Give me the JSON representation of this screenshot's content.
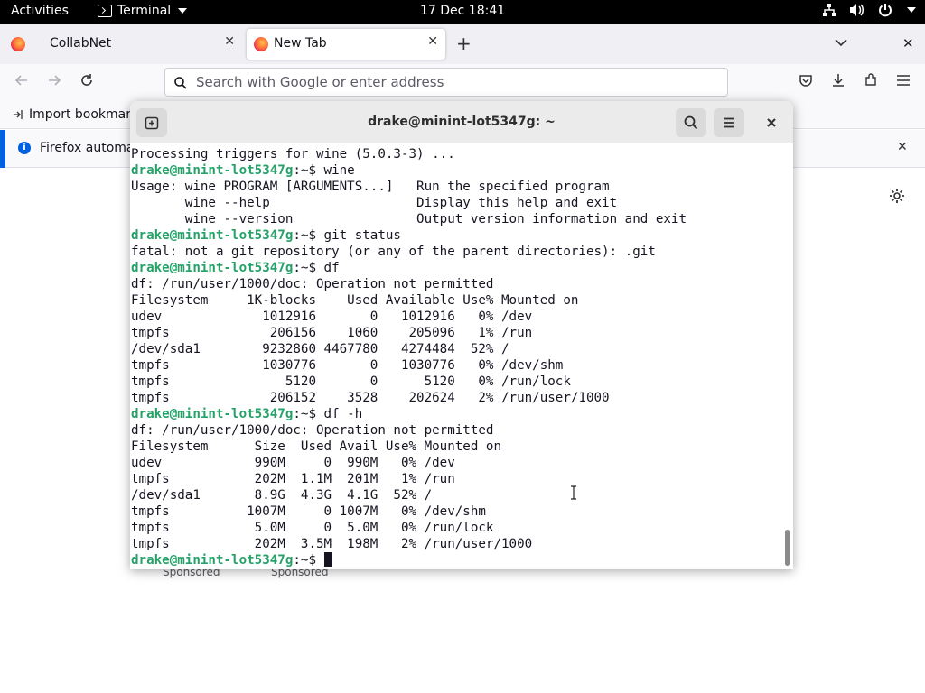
{
  "topbar": {
    "activities": "Activities",
    "app_name": "Terminal",
    "clock": "17 Dec  18:41",
    "tray_icons": [
      "network-icon",
      "volume-icon",
      "power-icon"
    ]
  },
  "firefox": {
    "tabs": [
      {
        "label": "CollabNet",
        "active": false
      },
      {
        "label": "New Tab",
        "active": true
      }
    ],
    "url_placeholder": "Search with Google or enter address",
    "bookmarks_label": "Import bookmark",
    "notification": "Firefox automa",
    "sponsored_1": "Sponsored",
    "sponsored_2": "Sponsored"
  },
  "terminal": {
    "title": "drake@minint-lot5347g: ~",
    "prompt": "drake@minint-lot5347g",
    "prompt_suffix": ":~$ ",
    "lines": [
      {
        "type": "out",
        "text": "Processing triggers for wine (5.0.3-3) ..."
      },
      {
        "type": "cmd",
        "text": "wine"
      },
      {
        "type": "out",
        "text": "Usage: wine PROGRAM [ARGUMENTS...]   Run the specified program"
      },
      {
        "type": "out",
        "text": "       wine --help                   Display this help and exit"
      },
      {
        "type": "out",
        "text": "       wine --version                Output version information and exit"
      },
      {
        "type": "cmd",
        "text": "git status"
      },
      {
        "type": "out",
        "text": "fatal: not a git repository (or any of the parent directories): .git"
      },
      {
        "type": "cmd",
        "text": "df"
      },
      {
        "type": "out",
        "text": "df: /run/user/1000/doc: Operation not permitted"
      },
      {
        "type": "out",
        "text": "Filesystem     1K-blocks    Used Available Use% Mounted on"
      },
      {
        "type": "out",
        "text": "udev             1012916       0   1012916   0% /dev"
      },
      {
        "type": "out",
        "text": "tmpfs             206156    1060    205096   1% /run"
      },
      {
        "type": "out",
        "text": "/dev/sda1        9232860 4467780   4274484  52% /"
      },
      {
        "type": "out",
        "text": "tmpfs            1030776       0   1030776   0% /dev/shm"
      },
      {
        "type": "out",
        "text": "tmpfs               5120       0      5120   0% /run/lock"
      },
      {
        "type": "out",
        "text": "tmpfs             206152    3528    202624   2% /run/user/1000"
      },
      {
        "type": "cmd",
        "text": "df -h"
      },
      {
        "type": "out",
        "text": "df: /run/user/1000/doc: Operation not permitted"
      },
      {
        "type": "out",
        "text": "Filesystem      Size  Used Avail Use% Mounted on"
      },
      {
        "type": "out",
        "text": "udev            990M     0  990M   0% /dev"
      },
      {
        "type": "out",
        "text": "tmpfs           202M  1.1M  201M   1% /run"
      },
      {
        "type": "out",
        "text": "/dev/sda1       8.9G  4.3G  4.1G  52% /"
      },
      {
        "type": "out",
        "text": "tmpfs          1007M     0 1007M   0% /dev/shm"
      },
      {
        "type": "out",
        "text": "tmpfs           5.0M     0  5.0M   0% /run/lock"
      },
      {
        "type": "out",
        "text": "tmpfs           202M  3.5M  198M   2% /run/user/1000"
      },
      {
        "type": "cmd",
        "text": ""
      }
    ]
  },
  "colors": {
    "prompt": "#26a269",
    "accent": "#0060df"
  }
}
